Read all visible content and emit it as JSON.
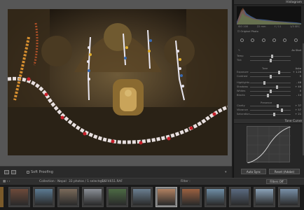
{
  "colors": {
    "panel_bg": "#262626",
    "viewer_bg": "#565656",
    "accent": "#b7b7b7"
  },
  "toolbar": {
    "soft_proofing_label": "Soft Proofing"
  },
  "panel": {
    "histogram_title": "Histogram",
    "histo_iso": "ISO 100",
    "histo_focal": "22 mm",
    "histo_aperture": "f / 11",
    "histo_shutter": "1/3 SEC",
    "original_photo_label": "Original Photo",
    "as_shot_label": "As Shot",
    "tone_label": "Tone",
    "auto_label": "Auto",
    "presence_label": "Presence",
    "tone_curve_title": "Tone Curve",
    "auto_sync_label": "Auto Sync",
    "reset_label": "Reset (Adobe)",
    "sliders": [
      {
        "label": "Temp",
        "value": "",
        "pos": 0.55
      },
      {
        "label": "Tint",
        "value": "",
        "pos": 0.5
      },
      {
        "label": "Exposure",
        "value": "+ 1.26",
        "pos": 0.72
      },
      {
        "label": "Contrast",
        "value": "0",
        "pos": 0.5
      },
      {
        "label": "Highlights",
        "value": "- 46",
        "pos": 0.35
      },
      {
        "label": "Shadows",
        "value": "+ 46",
        "pos": 0.66
      },
      {
        "label": "Whites",
        "value": "0",
        "pos": 0.5
      },
      {
        "label": "Blacks",
        "value": "- 14",
        "pos": 0.44
      },
      {
        "label": "Clarity",
        "value": "+ 37",
        "pos": 0.68
      },
      {
        "label": "Vibrance",
        "value": "+ 57",
        "pos": 0.78
      },
      {
        "label": "Saturation",
        "value": "+ 21",
        "pos": 0.6
      }
    ]
  },
  "filmbar": {
    "collection": "Collection : Nepal",
    "selected": "33 photos / 1 selected /",
    "filename": "_DSF4651.RAF",
    "filter_label": "Filter :",
    "filters_off": "Filters Off"
  },
  "filmstrip": {
    "thumb_colors": [
      "#6d4a3a",
      "#5b7a92",
      "#7a6a5a",
      "#8a8f96",
      "#4c6a44",
      "#6a7e90",
      "#b08060",
      "#9a6040",
      "#6e8ea6",
      "#5a6a80",
      "#8aa2b8",
      "#7890a8"
    ]
  }
}
